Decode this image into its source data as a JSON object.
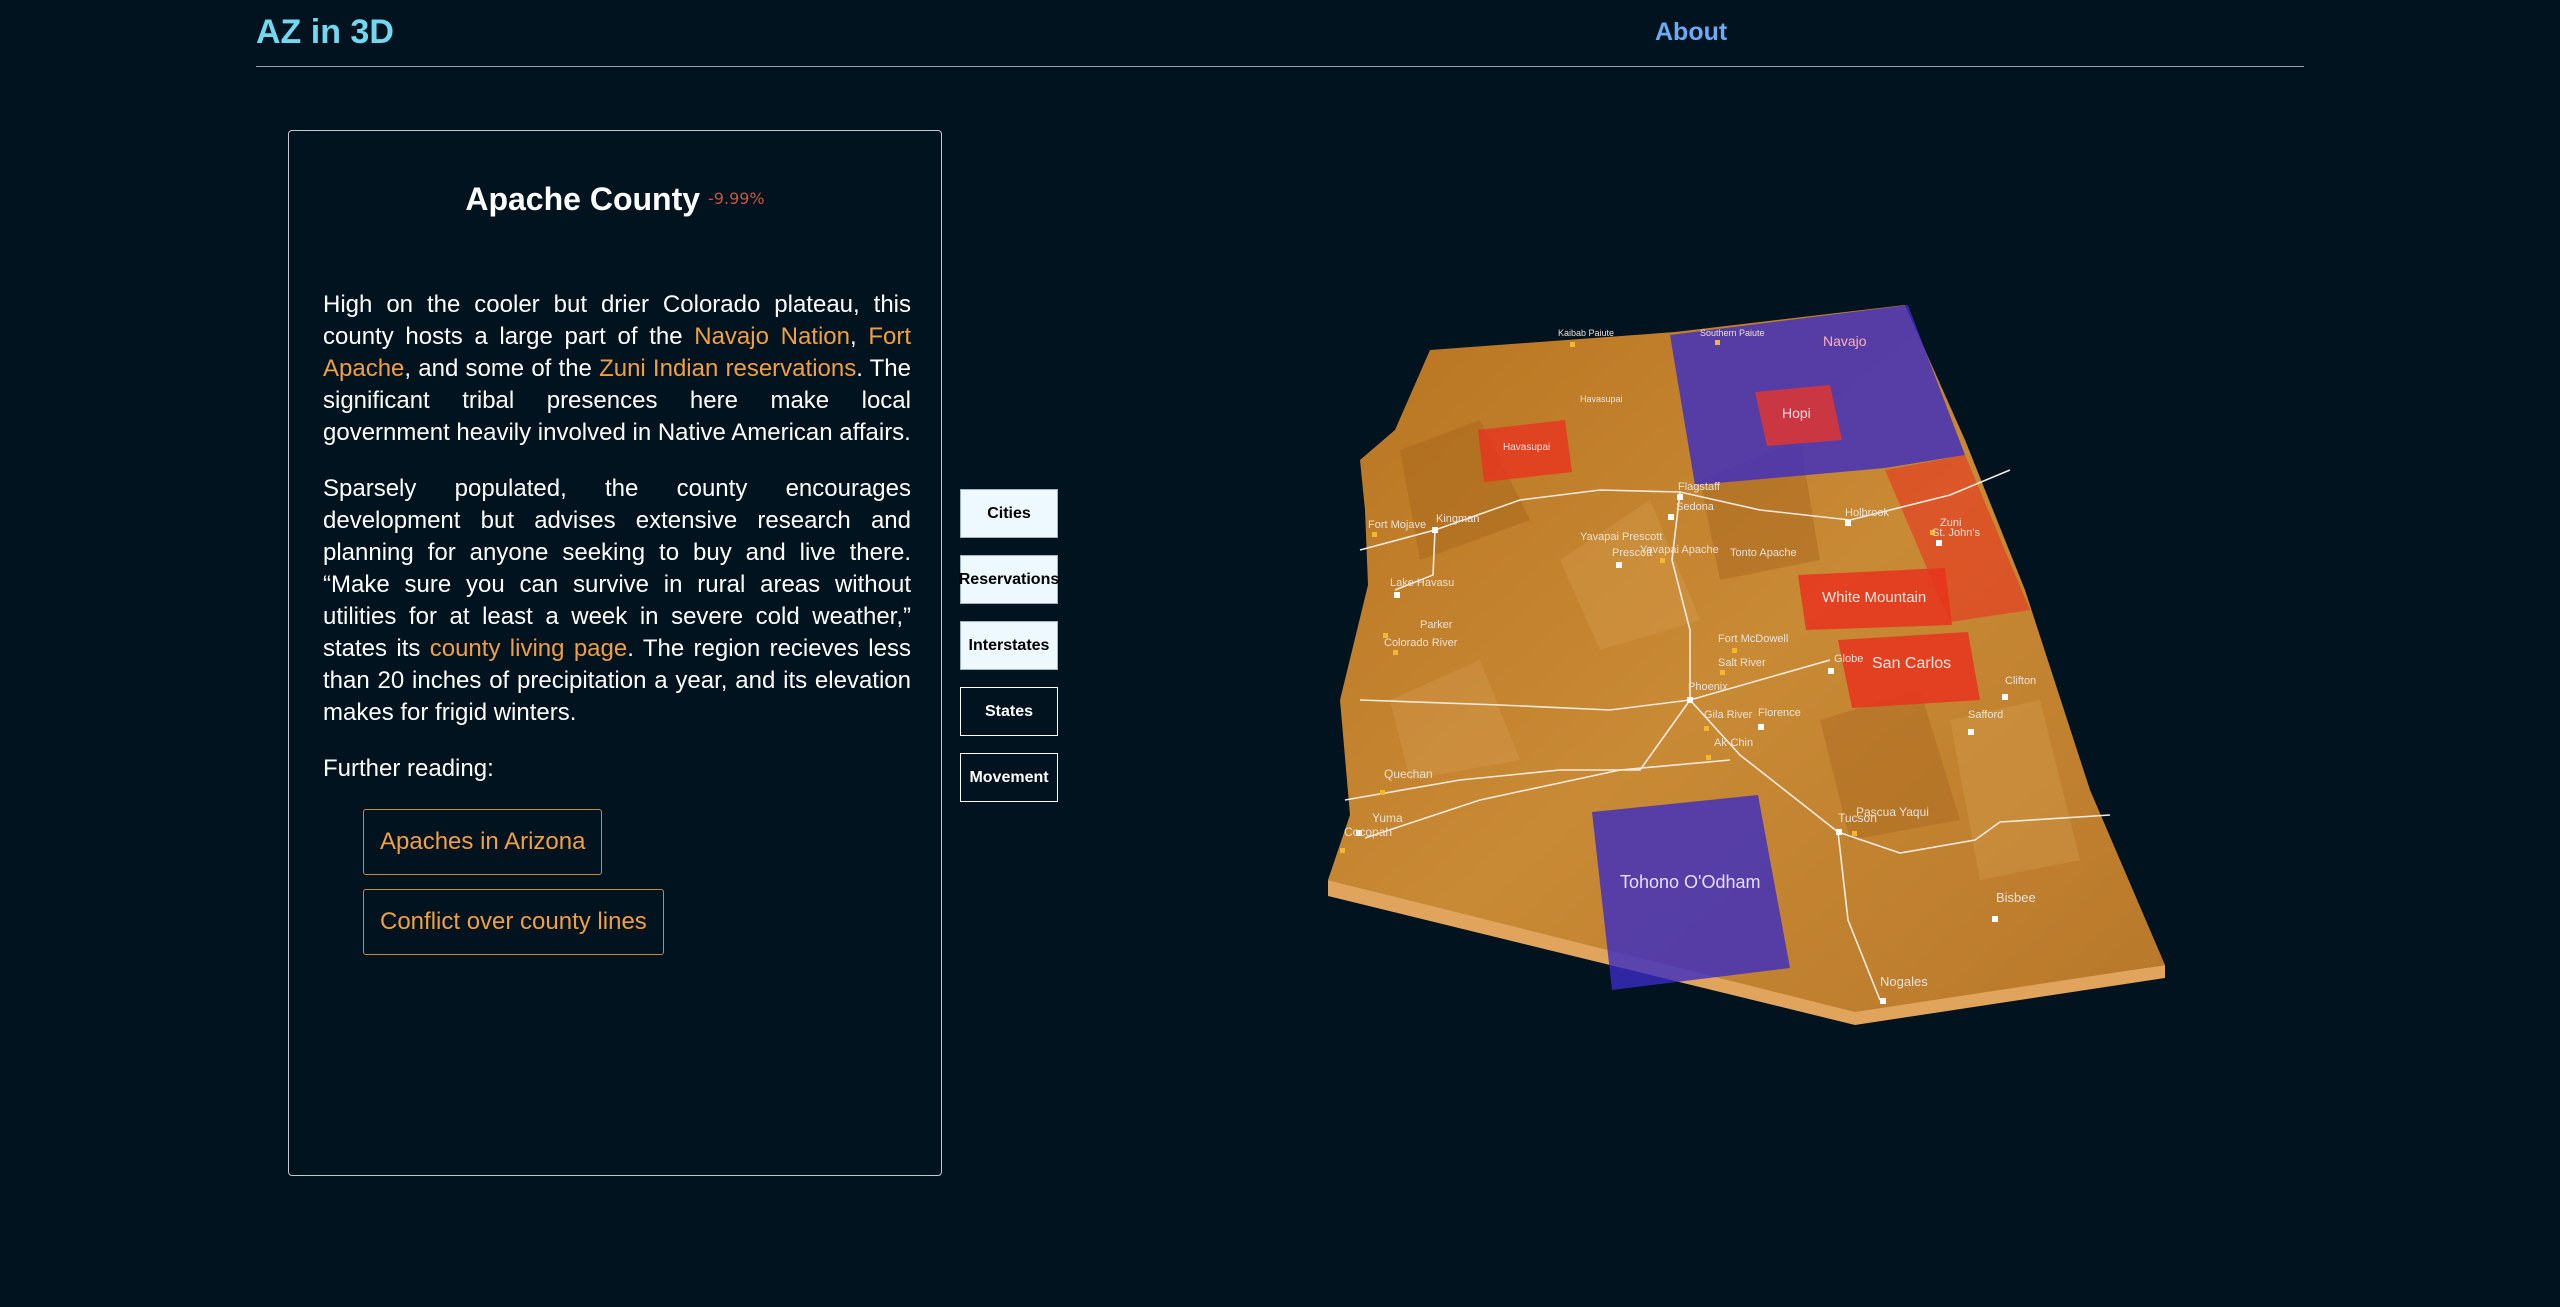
{
  "header": {
    "brand": "AZ in 3D",
    "about_label": "About"
  },
  "panel": {
    "title": "Apache County",
    "change": "-9.99%",
    "p1": {
      "t1": "High on the cooler but drier Colorado plateau, this county hosts a large part of the ",
      "link_navajo": "Navajo Nation",
      "t2": ", ",
      "link_fort_apache": "Fort Apache",
      "t3": ", and some of the ",
      "link_zuni": "Zuni Indian reservations",
      "t4": ".  The significant tribal presences here make local government heavily involved in Native American affairs."
    },
    "p2": {
      "t1": "Sparsely populated, the county encourages development but advises extensive research and planning for anyone seeking to buy and live there. “Make sure you can survive in rural areas without utilities for at least a week in severe cold weather,” states its ",
      "link_county": "county living page",
      "t2": ". The region recieves less than 20 inches of precipitation a year, and its elevation makes for frigid winters."
    },
    "further_label": "Further reading:",
    "reading": [
      "Apaches in Arizona",
      "Conflict over county lines"
    ]
  },
  "layers": [
    {
      "label": "Cities",
      "active": true
    },
    {
      "label": "Reservations",
      "active": true
    },
    {
      "label": "Interstates",
      "active": true
    },
    {
      "label": "States",
      "active": false
    },
    {
      "label": "Movement",
      "active": false
    }
  ],
  "map": {
    "colors": {
      "terrain": "#c07e2a",
      "terrain_light": "#e7a95c",
      "reservation_blue": "#3b2cc4",
      "reservation_red": "#e8341f"
    },
    "reservations": [
      "Navajo",
      "Hopi",
      "Havasupai",
      "White Mountain",
      "San Carlos",
      "Tohono O'Odham"
    ],
    "cities": [
      "Kaibab Paiute",
      "Southern Paiute",
      "Havasupai",
      "Flagstaff",
      "Sedona",
      "Fort Mojave",
      "Kingman",
      "Yavapai Prescott",
      "Prescott",
      "Yavapai Apache",
      "Tonto Apache",
      "Holbrook",
      "Zuni",
      "St. John's",
      "Lake Havasu",
      "Parker",
      "Colorado River",
      "Fort McDowell",
      "Salt River",
      "Phoenix",
      "Globe",
      "Gila River",
      "Florence",
      "Ak-Chin",
      "Quechan",
      "Yuma",
      "Cocopah",
      "Tucson",
      "Pascua Yaqui",
      "Safford",
      "Clifton",
      "Bisbee",
      "Nogales"
    ]
  }
}
